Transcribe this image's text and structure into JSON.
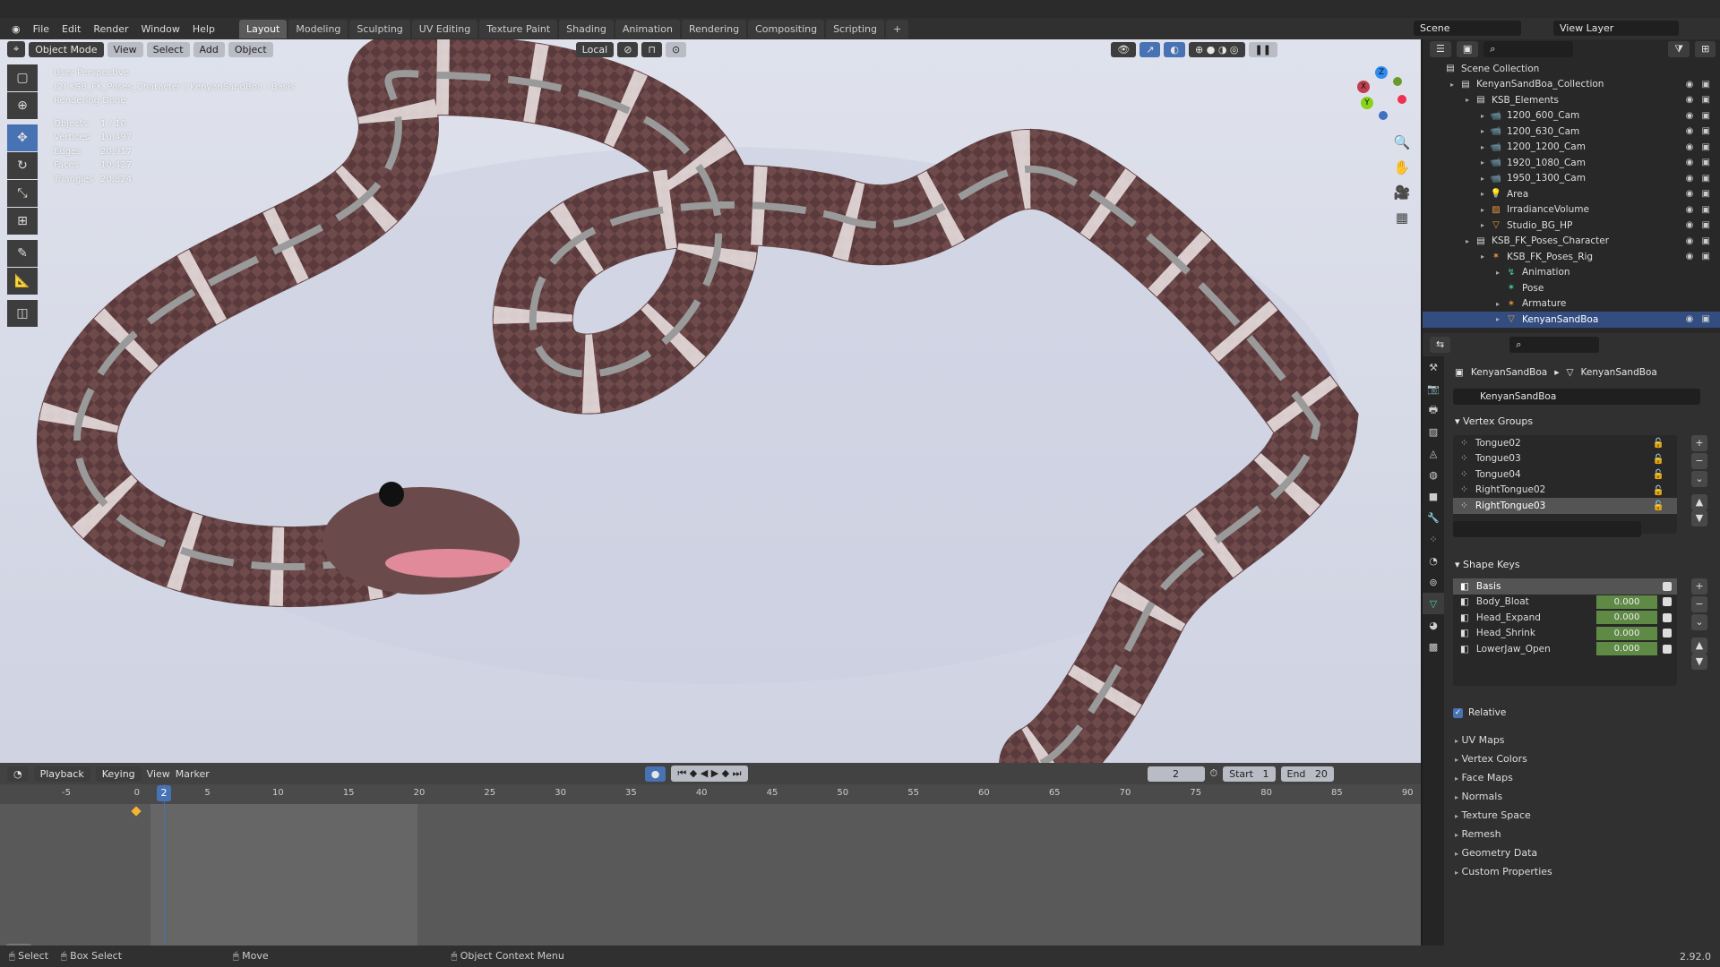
{
  "menu": {
    "items": [
      "File",
      "Edit",
      "Render",
      "Window",
      "Help"
    ]
  },
  "workspaces": [
    "Layout",
    "Modeling",
    "Sculpting",
    "UV Editing",
    "Texture Paint",
    "Shading",
    "Animation",
    "Rendering",
    "Compositing",
    "Scripting",
    "+"
  ],
  "scene": {
    "scene": "Scene",
    "view_layer": "View Layer"
  },
  "viewport": {
    "mode": "Object Mode",
    "menus": [
      "View",
      "Select",
      "Add",
      "Object"
    ],
    "orientation": "Local",
    "overlay": {
      "view": "User Perspective",
      "context": "(2) KSB_FK_Poses_Character | KenyanSandBoa : Basis",
      "status": "Rendering Done"
    },
    "stats": [
      {
        "label": "Objects",
        "value": "1 / 10"
      },
      {
        "label": "Vertices",
        "value": "10,497"
      },
      {
        "label": "Edges",
        "value": "20,917"
      },
      {
        "label": "Faces",
        "value": "10,427"
      },
      {
        "label": "Triangles",
        "value": "20,824"
      }
    ],
    "gizmo": {
      "z": "Z",
      "x": "X",
      "y": "Y"
    }
  },
  "outliner": {
    "rows": [
      {
        "label": "Scene Collection",
        "depth": 0,
        "icon": "collection"
      },
      {
        "label": "KenyanSandBoa_Collection",
        "depth": 1,
        "icon": "collection"
      },
      {
        "label": "KSB_Elements",
        "depth": 2,
        "icon": "collection"
      },
      {
        "label": "1200_600_Cam",
        "depth": 3,
        "icon": "camera"
      },
      {
        "label": "1200_630_Cam",
        "depth": 3,
        "icon": "camera"
      },
      {
        "label": "1200_1200_Cam",
        "depth": 3,
        "icon": "camera"
      },
      {
        "label": "1920_1080_Cam",
        "depth": 3,
        "icon": "camera"
      },
      {
        "label": "1950_1300_Cam",
        "depth": 3,
        "icon": "camera"
      },
      {
        "label": "Area",
        "depth": 3,
        "icon": "light"
      },
      {
        "label": "IrradianceVolume",
        "depth": 3,
        "icon": "probe"
      },
      {
        "label": "Studio_BG_HP",
        "depth": 3,
        "icon": "mesh"
      },
      {
        "label": "KSB_FK_Poses_Character",
        "depth": 2,
        "icon": "collection"
      },
      {
        "label": "KSB_FK_Poses_Rig",
        "depth": 3,
        "icon": "armature"
      },
      {
        "label": "Animation",
        "depth": 4,
        "icon": "action"
      },
      {
        "label": "Pose",
        "depth": 4,
        "icon": "pose"
      },
      {
        "label": "Armature",
        "depth": 4,
        "icon": "armature"
      },
      {
        "label": "KenyanSandBoa",
        "depth": 4,
        "icon": "mesh",
        "selected": true
      }
    ]
  },
  "properties": {
    "breadcrumb": [
      "KenyanSandBoa",
      "KenyanSandBoa"
    ],
    "mesh_name": "KenyanSandBoa",
    "vertex_groups_title": "Vertex Groups",
    "vertex_groups": [
      "Tongue02",
      "Tongue03",
      "Tongue04",
      "RightTongue02",
      "RightTongue03"
    ],
    "shape_keys_title": "Shape Keys",
    "shape_keys": [
      {
        "name": "Basis",
        "value": ""
      },
      {
        "name": "Body_Bloat",
        "value": "0.000"
      },
      {
        "name": "Head_Expand",
        "value": "0.000"
      },
      {
        "name": "Head_Shrink",
        "value": "0.000"
      },
      {
        "name": "LowerJaw_Open",
        "value": "0.000"
      }
    ],
    "relative_label": "Relative",
    "panels": [
      "UV Maps",
      "Vertex Colors",
      "Face Maps",
      "Normals",
      "Texture Space",
      "Remesh",
      "Geometry Data",
      "Custom Properties"
    ]
  },
  "timeline": {
    "menus": [
      "Playback",
      "Keying",
      "View",
      "Marker"
    ],
    "current_frame": "2",
    "start_label": "Start",
    "start": "1",
    "end_label": "End",
    "end": "20",
    "ticks": [
      "-5",
      "0",
      "5",
      "10",
      "15",
      "20",
      "25",
      "30",
      "35",
      "40",
      "45",
      "50",
      "55",
      "60",
      "65",
      "70",
      "75",
      "80",
      "85",
      "90"
    ]
  },
  "status": {
    "select": "Select",
    "box_select": "Box Select",
    "move": "Move",
    "context_menu": "Object Context Menu",
    "version": "2.92.0"
  }
}
